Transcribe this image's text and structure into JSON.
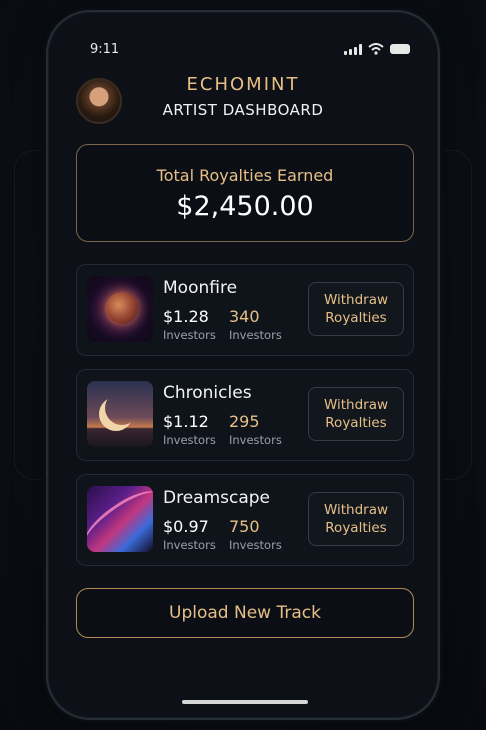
{
  "status_bar": {
    "time": "9:11",
    "signal_icon": "signal-icon",
    "wifi_icon": "wifi-icon",
    "battery_icon": "battery-icon"
  },
  "header": {
    "brand": "ECHOMINT",
    "subtitle": "ARTIST DASHBOARD",
    "avatar_icon": "artist-avatar"
  },
  "royalties": {
    "label": "Total Royalties Earned",
    "amount": "$2,450.00"
  },
  "tracks": [
    {
      "title": "Moonfire",
      "price": "$1.28",
      "price_label": "Investors",
      "count": "340",
      "count_label": "Investors",
      "button": "Withdraw\nRoyalties",
      "art": "moon-artwork"
    },
    {
      "title": "Chronicles",
      "price": "$1.12",
      "price_label": "Investors",
      "count": "295",
      "count_label": "Investors",
      "button": "Withdraw\nRoyalties",
      "art": "crescent-artwork"
    },
    {
      "title": "Dreamscape",
      "price": "$0.97",
      "price_label": "Investors",
      "count": "750",
      "count_label": "Investors",
      "button": "Withdraw\nRoyalties",
      "art": "wave-artwork"
    }
  ],
  "upload_button": "Upload New Track",
  "colors": {
    "accent_gold": "#e6bf87",
    "background": "#0d1117",
    "card_border": "#7a6546"
  }
}
